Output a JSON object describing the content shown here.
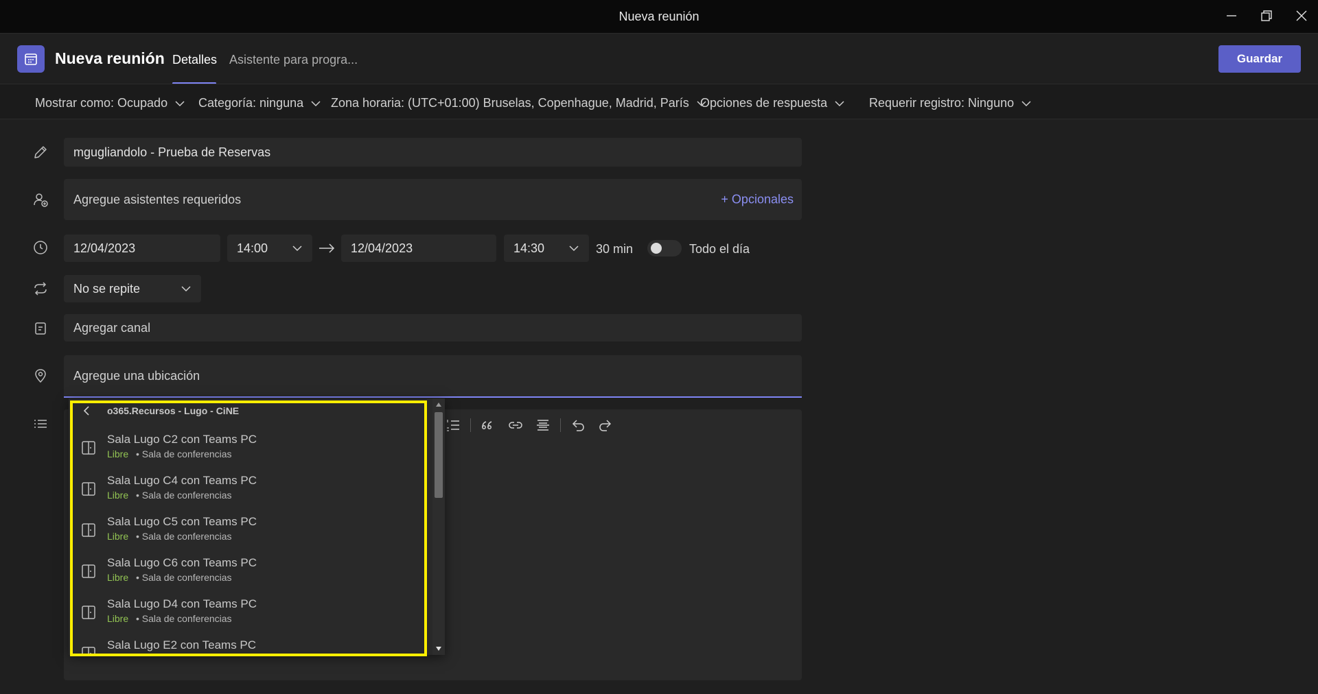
{
  "window": {
    "title": "Nueva reunión"
  },
  "header": {
    "title": "Nueva reunión",
    "tabs": [
      {
        "label": "Detalles"
      },
      {
        "label": "Asistente para progra..."
      }
    ],
    "save_label": "Guardar"
  },
  "options": {
    "show_as": "Mostrar como: Ocupado",
    "category": "Categoría: ninguna",
    "timezone": "Zona horaria: (UTC+01:00) Bruselas, Copenhague, Madrid, París",
    "response": "Opciones de respuesta",
    "registration": "Requerir registro: Ninguno"
  },
  "form": {
    "title_value": "mgugliandolo - Prueba de Reservas",
    "attendees_placeholder": "Agregue asistentes requeridos",
    "optional_link": "+ Opcionales",
    "start_date": "12/04/2023",
    "start_time": "14:00",
    "end_date": "12/04/2023",
    "end_time": "14:30",
    "duration": "30 min",
    "all_day_label": "Todo el día",
    "all_day_on": false,
    "repeat": "No se repite",
    "channel_placeholder": "Agregar canal",
    "location_placeholder": "Agregue una ubicación"
  },
  "location_dropdown": {
    "header": "o365.Recursos - Lugo - CiNE",
    "items": [
      {
        "name": "Sala Lugo C2 con Teams PC",
        "status": "Libre",
        "type": "• Sala de conferencias"
      },
      {
        "name": "Sala Lugo C4 con Teams PC",
        "status": "Libre",
        "type": "• Sala de conferencias"
      },
      {
        "name": "Sala Lugo C5 con Teams PC",
        "status": "Libre",
        "type": "• Sala de conferencias"
      },
      {
        "name": "Sala Lugo C6 con Teams PC",
        "status": "Libre",
        "type": "• Sala de conferencias"
      },
      {
        "name": "Sala Lugo D4 con Teams PC",
        "status": "Libre",
        "type": "• Sala de conferencias"
      },
      {
        "name": "Sala Lugo E2 con Teams PC"
      }
    ],
    "highlight_color": "#ffee00"
  },
  "colors": {
    "accent": "#5b5fc7",
    "accent_light": "#7f85f5",
    "status_free": "#92c353"
  },
  "icons": {
    "app": "calendar-icon",
    "title_row": "pencil-icon",
    "attendees_row": "add-person-icon",
    "time_row": "clock-icon",
    "repeat_row": "repeat-icon",
    "channel_row": "channel-icon",
    "location_row": "location-pin-icon",
    "details_row": "text-list-icon"
  }
}
